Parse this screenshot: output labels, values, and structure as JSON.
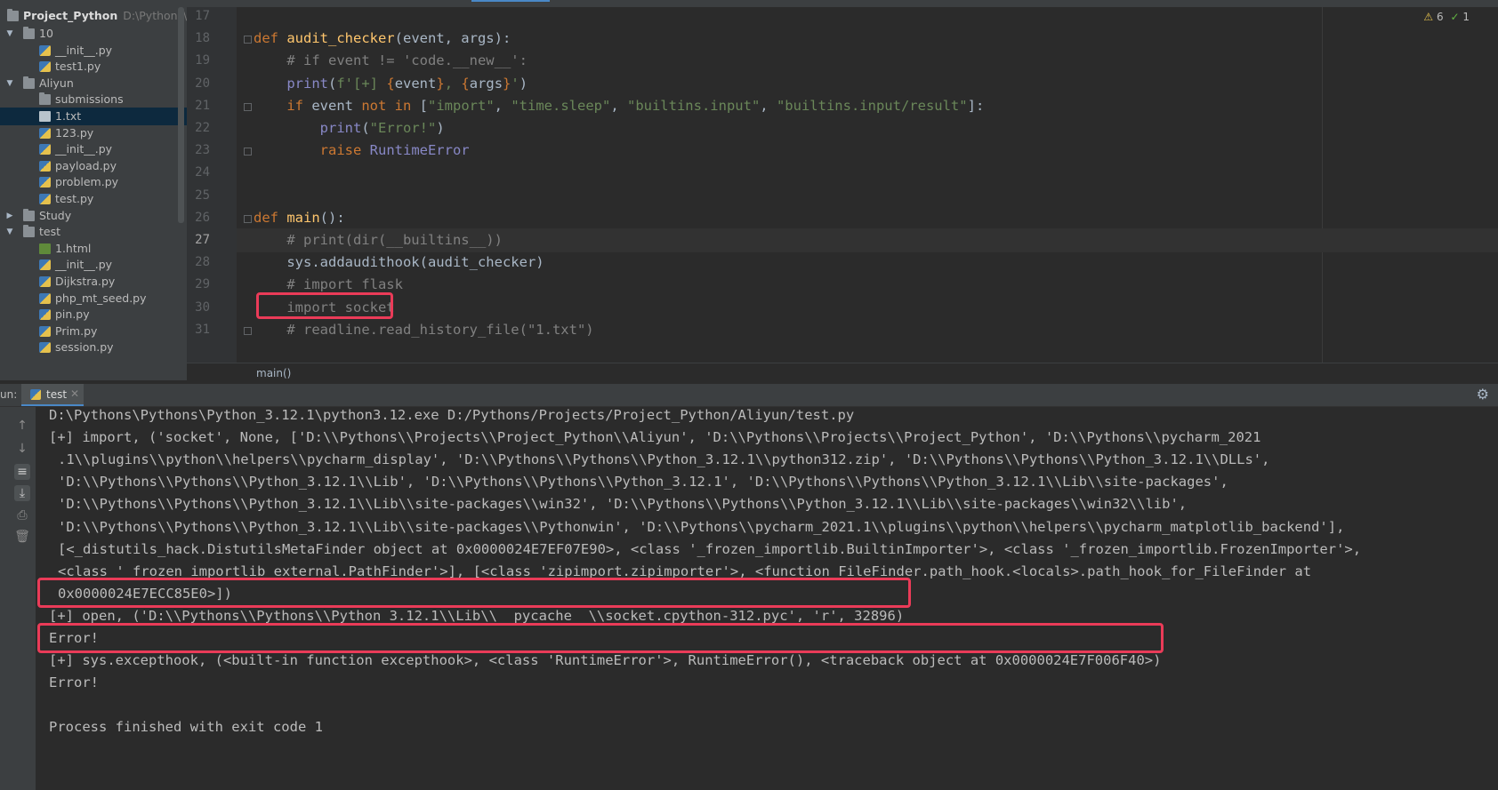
{
  "project": {
    "root_name": "Project_Python",
    "root_path": "D:\\Pythons\\Pro",
    "tree": [
      {
        "label": "10",
        "type": "folder",
        "level": 1,
        "expanded": true
      },
      {
        "label": "__init__.py",
        "type": "py",
        "level": 2
      },
      {
        "label": "test1.py",
        "type": "py",
        "level": 2
      },
      {
        "label": "Aliyun",
        "type": "folder",
        "level": 1,
        "expanded": true
      },
      {
        "label": "submissions",
        "type": "folder",
        "level": 2
      },
      {
        "label": "1.txt",
        "type": "txt",
        "level": 2,
        "selected": true
      },
      {
        "label": "123.py",
        "type": "py",
        "level": 2
      },
      {
        "label": "__init__.py",
        "type": "py",
        "level": 2
      },
      {
        "label": "payload.py",
        "type": "py",
        "level": 2
      },
      {
        "label": "problem.py",
        "type": "py",
        "level": 2
      },
      {
        "label": "test.py",
        "type": "py",
        "level": 2
      },
      {
        "label": "Study",
        "type": "folder",
        "level": 1,
        "expanded": false
      },
      {
        "label": "test",
        "type": "folder",
        "level": 1,
        "expanded": true
      },
      {
        "label": "1.html",
        "type": "html",
        "level": 2
      },
      {
        "label": "__init__.py",
        "type": "py",
        "level": 2
      },
      {
        "label": "Dijkstra.py",
        "type": "py",
        "level": 2
      },
      {
        "label": "php_mt_seed.py",
        "type": "py",
        "level": 2
      },
      {
        "label": "pin.py",
        "type": "py",
        "level": 2
      },
      {
        "label": "Prim.py",
        "type": "py",
        "level": 2
      },
      {
        "label": "session.py",
        "type": "py",
        "level": 2
      }
    ]
  },
  "editor": {
    "inspections": {
      "warnings": "6",
      "ok": "1"
    },
    "current_line": "27",
    "breadcrumb": "main()",
    "lines": [
      {
        "n": "17",
        "html": ""
      },
      {
        "n": "18",
        "html": "<span class=\"kw\">def </span><span class=\"fn\">audit_checker</span>(event, args):"
      },
      {
        "n": "19",
        "html": "    <span class=\"cm\"># if event != 'code.__new__':</span>"
      },
      {
        "n": "20",
        "html": "    <span class=\"bi\">print</span>(<span class=\"str\">f'[+] </span><span class=\"kw\">{</span>event<span class=\"kw\">}</span><span class=\"str\">, </span><span class=\"kw\">{</span>args<span class=\"kw\">}</span><span class=\"str\">'</span>)"
      },
      {
        "n": "21",
        "html": "    <span class=\"kw\">if </span>event <span class=\"kw\">not in </span>[<span class=\"str\">\"import\"</span>, <span class=\"str\">\"time.sleep\"</span>, <span class=\"str\">\"builtins.input\"</span>, <span class=\"str\">\"builtins.input/result\"</span>]:"
      },
      {
        "n": "22",
        "html": "        <span class=\"bi\">print</span>(<span class=\"str\">\"Error!\"</span>)"
      },
      {
        "n": "23",
        "html": "        <span class=\"kw\">raise </span><span class=\"bi\">RuntimeError</span>"
      },
      {
        "n": "24",
        "html": ""
      },
      {
        "n": "25",
        "html": ""
      },
      {
        "n": "26",
        "html": "<span class=\"kw\">def </span><span class=\"fn\">main</span>():"
      },
      {
        "n": "27",
        "html": "    <span class=\"cm\"># print(dir(__builtins__))</span>"
      },
      {
        "n": "28",
        "html": "    sys.addaudithook(audit_checker)"
      },
      {
        "n": "29",
        "html": "    <span class=\"cm\"># import flask</span>"
      },
      {
        "n": "30",
        "html": "    <span class=\"cm\">import socket</span>"
      },
      {
        "n": "31",
        "html": "    <span class=\"cm\"># readline.read_history_file(\"1.txt\")</span>"
      }
    ]
  },
  "run": {
    "label": "un:",
    "tab_name": "test",
    "close_glyph": "✕",
    "console_lines": [
      {
        "text": "D:\\Pythons\\Pythons\\Python_3.12.1\\python3.12.exe D:/Pythons/Projects/Project_Python/Aliyun/test.py",
        "cont": false
      },
      {
        "text": "[+] import, ('socket', None, ['D:\\\\Pythons\\\\Projects\\\\Project_Python\\\\Aliyun', 'D:\\\\Pythons\\\\Projects\\\\Project_Python', 'D:\\\\Pythons\\\\pycharm_2021",
        "cont": false
      },
      {
        "text": ".1\\\\plugins\\\\python\\\\helpers\\\\pycharm_display', 'D:\\\\Pythons\\\\Pythons\\\\Python_3.12.1\\\\python312.zip', 'D:\\\\Pythons\\\\Pythons\\\\Python_3.12.1\\\\DLLs',",
        "cont": true
      },
      {
        "text": "'D:\\\\Pythons\\\\Pythons\\\\Python_3.12.1\\\\Lib', 'D:\\\\Pythons\\\\Pythons\\\\Python_3.12.1', 'D:\\\\Pythons\\\\Pythons\\\\Python_3.12.1\\\\Lib\\\\site-packages',",
        "cont": true
      },
      {
        "text": "'D:\\\\Pythons\\\\Pythons\\\\Python_3.12.1\\\\Lib\\\\site-packages\\\\win32', 'D:\\\\Pythons\\\\Pythons\\\\Python_3.12.1\\\\Lib\\\\site-packages\\\\win32\\\\lib',",
        "cont": true
      },
      {
        "text": "'D:\\\\Pythons\\\\Pythons\\\\Python_3.12.1\\\\Lib\\\\site-packages\\\\Pythonwin', 'D:\\\\Pythons\\\\pycharm_2021.1\\\\plugins\\\\python\\\\helpers\\\\pycharm_matplotlib_backend'],",
        "cont": true
      },
      {
        "text": "[<_distutils_hack.DistutilsMetaFinder object at 0x0000024E7EF07E90>, <class '_frozen_importlib.BuiltinImporter'>, <class '_frozen_importlib.FrozenImporter'>,",
        "cont": true
      },
      {
        "text": "<class '_frozen_importlib_external.PathFinder'>], [<class 'zipimport.zipimporter'>, <function FileFinder.path_hook.<locals>.path_hook_for_FileFinder at",
        "cont": true
      },
      {
        "text": "0x0000024E7ECC85E0>])",
        "cont": true
      },
      {
        "text": "[+] open, ('D:\\\\Pythons\\\\Pythons\\\\Python_3.12.1\\\\Lib\\\\__pycache__\\\\socket.cpython-312.pyc', 'r', 32896)",
        "cont": false
      },
      {
        "text": "Error!",
        "cont": false
      },
      {
        "text": "[+] sys.excepthook, (<built-in function excepthook>, <class 'RuntimeError'>, RuntimeError(), <traceback object at 0x0000024E7F006F40>)",
        "cont": false
      },
      {
        "text": "Error!",
        "cont": false
      },
      {
        "text": "",
        "cont": false
      },
      {
        "text": "Process finished with exit code 1",
        "cont": false
      }
    ]
  },
  "colors": {
    "highlight": "#ea3b58",
    "accent": "#4a88c7"
  }
}
